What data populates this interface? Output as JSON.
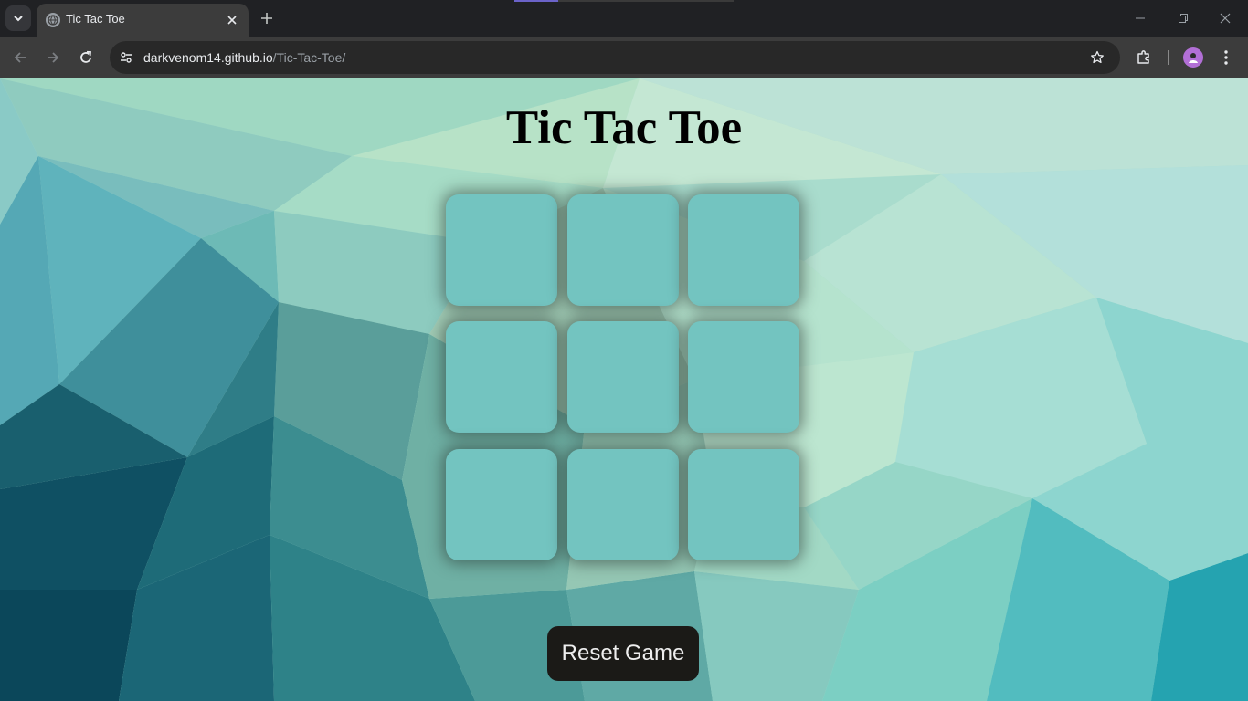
{
  "browser": {
    "tab": {
      "title": "Tic Tac Toe"
    },
    "address_bar": {
      "host": "darkvenom14.github.io",
      "path": "/Tic-Tac-Toe/"
    }
  },
  "game": {
    "title": "Tic Tac Toe",
    "board": {
      "cells": [
        "",
        "",
        "",
        "",
        "",
        "",
        "",
        "",
        ""
      ]
    },
    "reset_label": "Reset Game"
  },
  "colors": {
    "cell": "#73c4c0",
    "reset_button_bg": "#1b1a17",
    "reset_button_text": "#eeeeee",
    "title_text": "#000000"
  },
  "icons": {
    "tab_search": "chevron-down-icon",
    "favicon": "globe-icon",
    "tab_close": "close-icon",
    "new_tab": "plus-icon",
    "back": "back-arrow-icon",
    "forward": "forward-arrow-icon",
    "reload": "reload-icon",
    "site_info": "tune-icon",
    "bookmark": "star-icon",
    "extensions": "puzzle-icon",
    "profile": "profile-avatar-icon",
    "menu": "kebab-menu-icon",
    "minimize": "minimize-icon",
    "restore": "restore-icon",
    "close_window": "close-window-icon"
  }
}
